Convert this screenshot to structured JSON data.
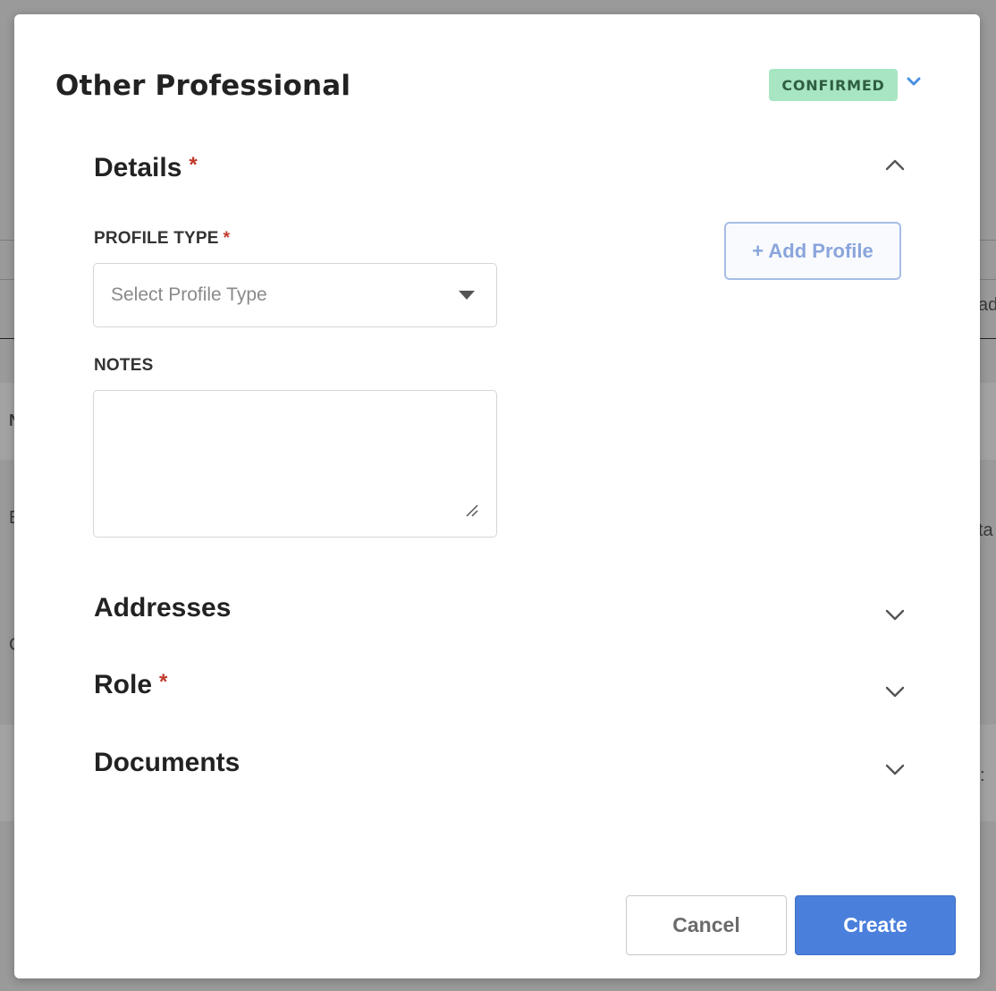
{
  "modal": {
    "title": "Other Professional",
    "status": "CONFIRMED",
    "accent_color": "#4a7fdc",
    "status_color": "#a8e6c3"
  },
  "sections": {
    "details": {
      "title": "Details",
      "required": "*",
      "expanded": true
    },
    "addresses": {
      "title": "Addresses"
    },
    "role": {
      "title": "Role",
      "required": "*"
    },
    "documents": {
      "title": "Documents"
    }
  },
  "details_form": {
    "profile_type_label": "PROFILE TYPE",
    "profile_type_required": "*",
    "profile_type_placeholder": "Select Profile Type",
    "notes_label": "NOTES",
    "notes_value": "",
    "add_profile_label": "+ Add Profile"
  },
  "footer": {
    "cancel_label": "Cancel",
    "create_label": "Create"
  },
  "background": {
    "fragment_1": "N",
    "fragment_2": "E",
    "fragment_3": "C",
    "fragment_4": "ad",
    "fragment_5": "ta",
    "fragment_6": ":"
  }
}
